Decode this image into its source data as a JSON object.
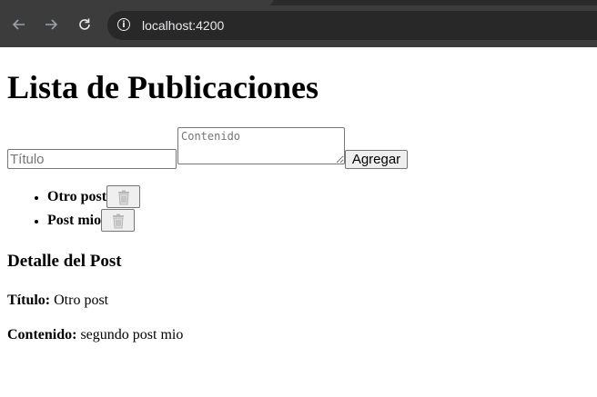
{
  "browser": {
    "url": "localhost:4200",
    "icons": [
      "back-arrow-icon",
      "forward-arrow-icon",
      "reload-icon",
      "site-info-icon"
    ]
  },
  "page": {
    "heading": "Lista de Publicaciones",
    "form": {
      "title_placeholder": "Título",
      "content_placeholder": "Contenido",
      "add_label": "Agregar"
    },
    "posts": [
      {
        "title": "Otro post",
        "delete_icon": "trash-icon"
      },
      {
        "title": "Post mio",
        "delete_icon": "trash-icon"
      }
    ],
    "detail": {
      "heading": "Detalle del Post",
      "title_label": "Título:",
      "title_value": "Otro post",
      "content_label": "Contenido:",
      "content_value": "segundo post mio"
    }
  }
}
